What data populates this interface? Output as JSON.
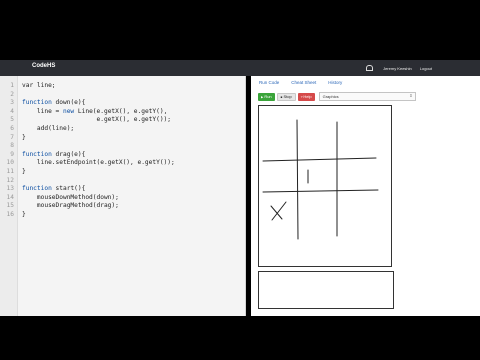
{
  "header": {
    "logo": "CodeHS",
    "user_name": "Jeremy Keeshin",
    "logout": "Logout"
  },
  "editor": {
    "lines": [
      {
        "n": "1",
        "segments": [
          {
            "t": "var line;",
            "c": ""
          }
        ]
      },
      {
        "n": "2",
        "segments": [
          {
            "t": "",
            "c": ""
          }
        ]
      },
      {
        "n": "3",
        "segments": [
          {
            "t": "function",
            "c": "kw"
          },
          {
            "t": " down(e){",
            "c": ""
          }
        ]
      },
      {
        "n": "4",
        "segments": [
          {
            "t": "    line = ",
            "c": ""
          },
          {
            "t": "new",
            "c": "kw"
          },
          {
            "t": " Line(e.getX(), e.getY(),",
            "c": ""
          }
        ]
      },
      {
        "n": "5",
        "segments": [
          {
            "t": "                    e.getX(), e.getY());",
            "c": ""
          }
        ]
      },
      {
        "n": "6",
        "segments": [
          {
            "t": "    add(line);",
            "c": ""
          }
        ]
      },
      {
        "n": "7",
        "segments": [
          {
            "t": "}",
            "c": ""
          }
        ]
      },
      {
        "n": "8",
        "segments": [
          {
            "t": "",
            "c": ""
          }
        ]
      },
      {
        "n": "9",
        "segments": [
          {
            "t": "function",
            "c": "kw"
          },
          {
            "t": " drag(e){",
            "c": ""
          }
        ]
      },
      {
        "n": "10",
        "segments": [
          {
            "t": "    line.setEndpoint(e.getX(), e.getY());",
            "c": ""
          }
        ]
      },
      {
        "n": "11",
        "segments": [
          {
            "t": "}",
            "c": ""
          }
        ]
      },
      {
        "n": "12",
        "segments": [
          {
            "t": "",
            "c": ""
          }
        ]
      },
      {
        "n": "13",
        "segments": [
          {
            "t": "function",
            "c": "kw"
          },
          {
            "t": " start(){",
            "c": ""
          }
        ]
      },
      {
        "n": "14",
        "segments": [
          {
            "t": "    mouseDownMethod(down);",
            "c": ""
          }
        ]
      },
      {
        "n": "15",
        "segments": [
          {
            "t": "    mouseDragMethod(drag);",
            "c": ""
          }
        ]
      },
      {
        "n": "16",
        "segments": [
          {
            "t": "}",
            "c": ""
          }
        ]
      }
    ]
  },
  "tabs": [
    "Run Code",
    "Cheat Sheet",
    "History"
  ],
  "toolbar": {
    "run": "Run",
    "stop": "Stop",
    "help": "Help",
    "graphics_value": "Graphics"
  },
  "canvas_strokes": [
    "tic-tac-toe grid lines",
    "mark 1",
    "X mark"
  ],
  "colors": {
    "header_bg": "#2b2d33",
    "run": "#3aa43a",
    "help": "#d54a4a",
    "link": "#2b67b8"
  }
}
